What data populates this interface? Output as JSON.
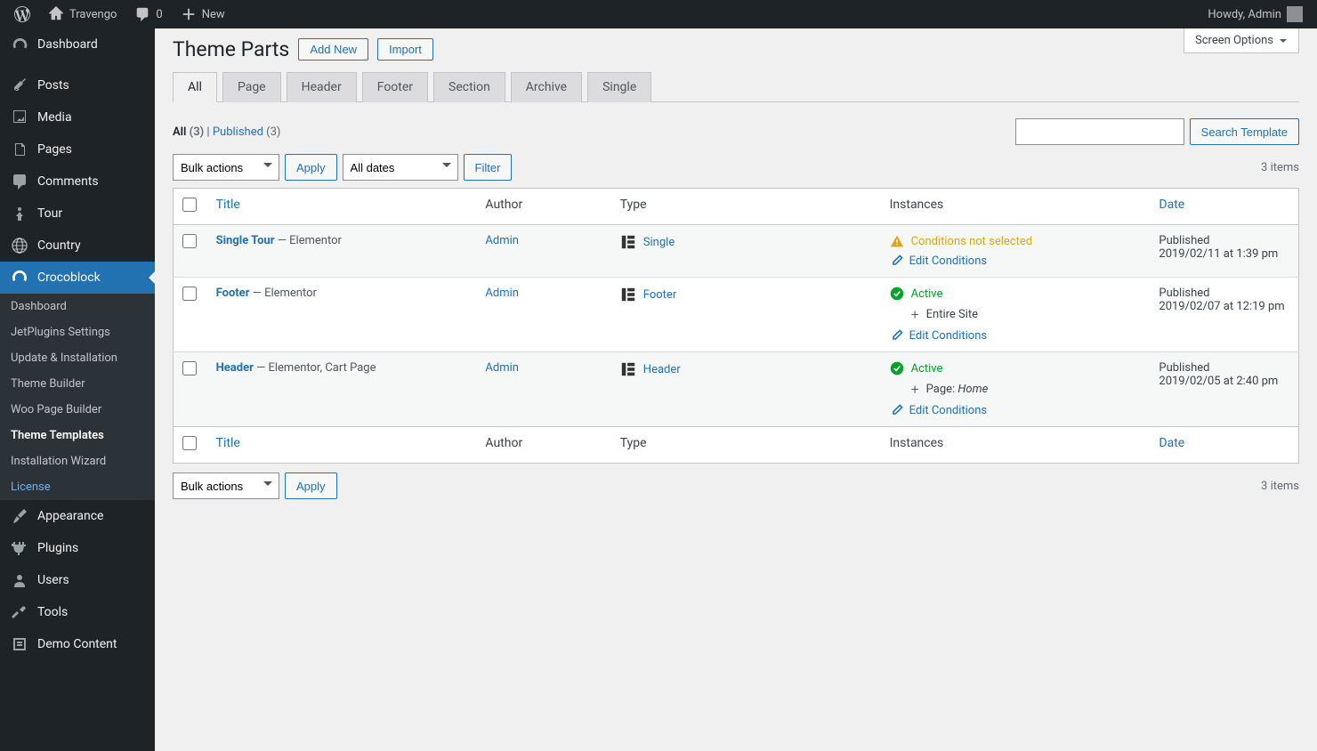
{
  "adminbar": {
    "site_name": "Travengo",
    "comments_count": "0",
    "new_label": "New",
    "howdy": "Howdy, Admin"
  },
  "sidebar": {
    "items": [
      {
        "label": "Dashboard"
      },
      {
        "label": "Posts"
      },
      {
        "label": "Media"
      },
      {
        "label": "Pages"
      },
      {
        "label": "Comments"
      },
      {
        "label": "Tour"
      },
      {
        "label": "Country"
      },
      {
        "label": "Crocoblock"
      },
      {
        "label": "Appearance"
      },
      {
        "label": "Plugins"
      },
      {
        "label": "Users"
      },
      {
        "label": "Tools"
      },
      {
        "label": "Demo Content"
      }
    ],
    "submenu": [
      {
        "label": "Dashboard"
      },
      {
        "label": "JetPlugins Settings"
      },
      {
        "label": "Update & Installation"
      },
      {
        "label": "Theme Builder"
      },
      {
        "label": "Woo Page Builder"
      },
      {
        "label": "Theme Templates"
      },
      {
        "label": "Installation Wizard"
      },
      {
        "label": "License"
      }
    ]
  },
  "screen_options": "Screen Options",
  "page": {
    "title": "Theme Parts",
    "add_new": "Add New",
    "import": "Import"
  },
  "tabs": [
    {
      "label": "All"
    },
    {
      "label": "Page"
    },
    {
      "label": "Header"
    },
    {
      "label": "Footer"
    },
    {
      "label": "Section"
    },
    {
      "label": "Archive"
    },
    {
      "label": "Single"
    }
  ],
  "filter": {
    "all_label": "All",
    "all_count": "(3)",
    "published_label": "Published",
    "published_count": "(3)",
    "sep": " | "
  },
  "search": {
    "button": "Search Template"
  },
  "bulk": {
    "placeholder": "Bulk actions",
    "apply": "Apply"
  },
  "dates": {
    "placeholder": "All dates",
    "filter": "Filter"
  },
  "items_count": "3 items",
  "columns": {
    "title": "Title",
    "author": "Author",
    "type": "Type",
    "instances": "Instances",
    "date": "Date"
  },
  "rows": [
    {
      "title": "Single Tour",
      "title_suffix": " — Elementor",
      "author": "Admin",
      "type": "Single",
      "status": "warning",
      "status_text": "Conditions not selected",
      "scope": "",
      "scope_detail": "",
      "edit": "Edit Conditions",
      "date_status": "Published",
      "date_text": "2019/02/11 at 1:39 pm"
    },
    {
      "title": "Footer",
      "title_suffix": " — Elementor",
      "author": "Admin",
      "type": "Footer",
      "status": "active",
      "status_text": "Active",
      "scope": "Entire Site",
      "scope_detail": "",
      "edit": "Edit Conditions",
      "date_status": "Published",
      "date_text": "2019/02/07 at 12:19 pm"
    },
    {
      "title": "Header",
      "title_suffix": " — Elementor, Cart Page",
      "author": "Admin",
      "type": "Header",
      "status": "active",
      "status_text": "Active",
      "scope": "Page: ",
      "scope_detail": "Home",
      "edit": "Edit Conditions",
      "date_status": "Published",
      "date_text": "2019/02/05 at 2:40 pm"
    }
  ]
}
